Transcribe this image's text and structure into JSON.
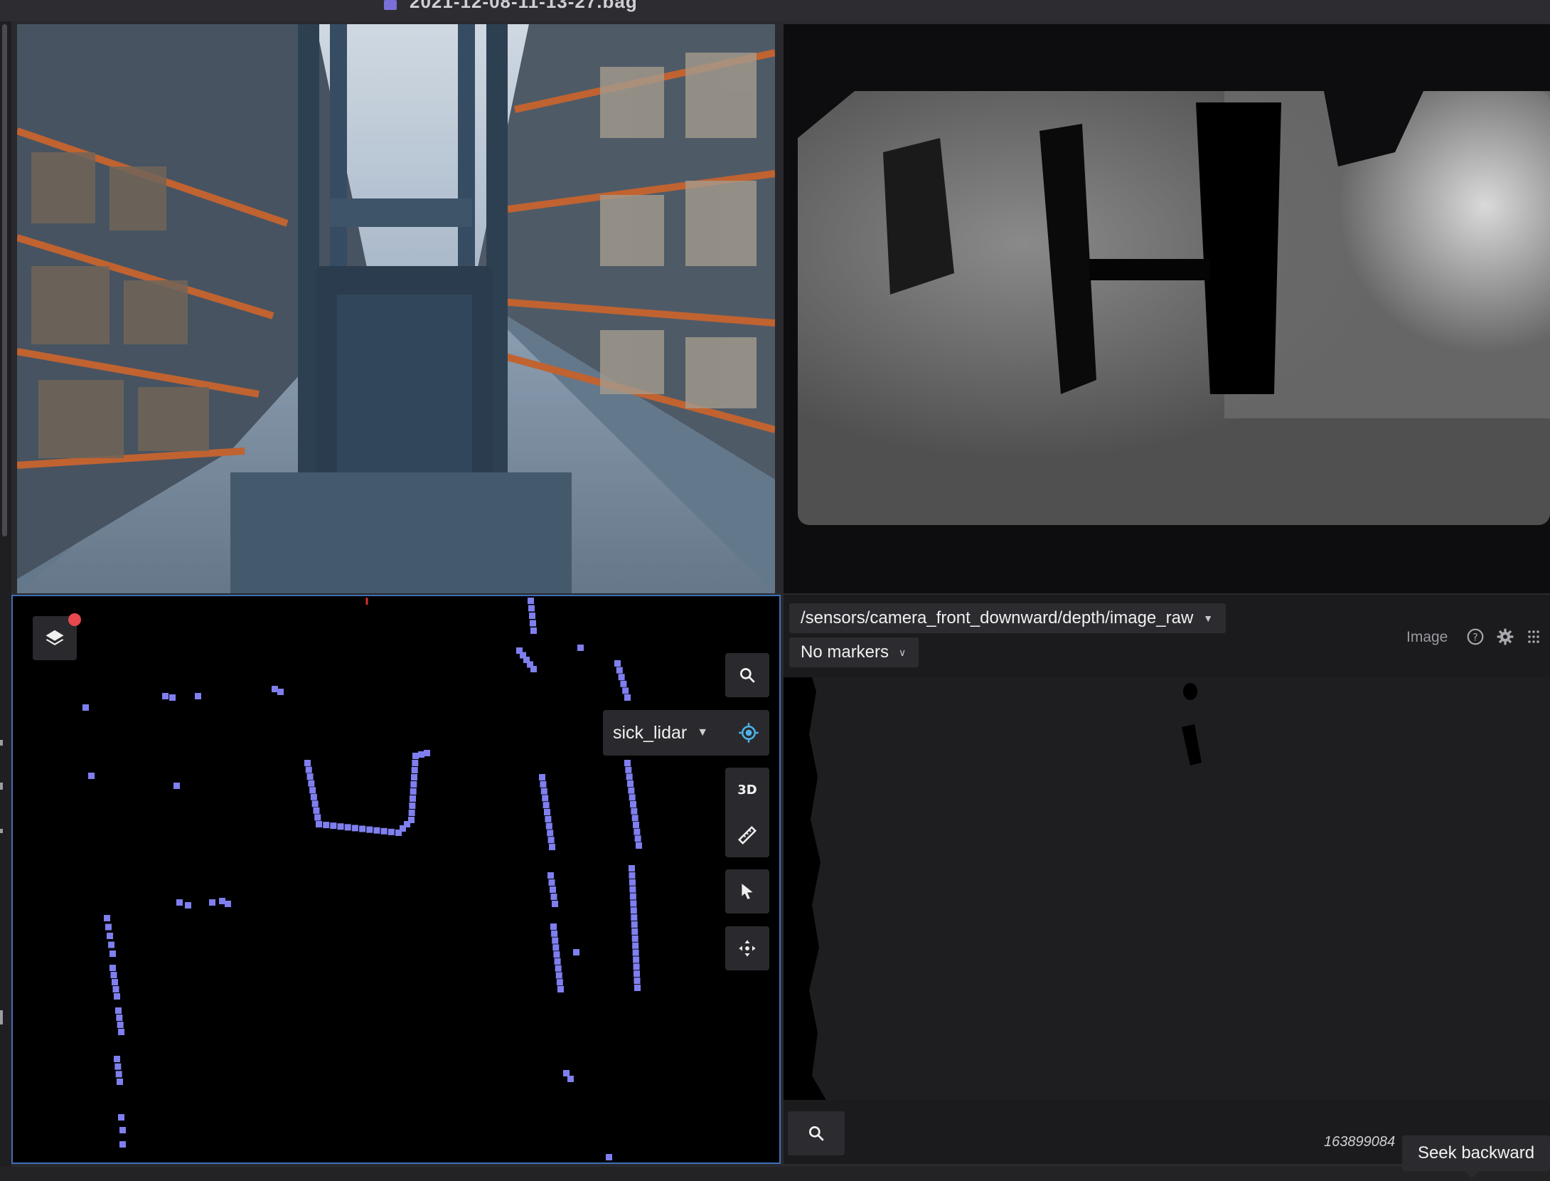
{
  "window": {
    "file_title": "2021-12-08-11-13-27.bag"
  },
  "three_d_panel": {
    "frame_select_value": "sick_lidar",
    "mode_3d_label": "3D",
    "lidar_point_color": "#7f7ff0",
    "layers_badge_color": "#e5484d"
  },
  "image_panel": {
    "topic_value": "/sensors/camera_front_downward/depth/image_raw",
    "markers_value": "No markers",
    "panel_type_label": "Image",
    "timestamp": "163899084"
  },
  "tooltip": {
    "text": "Seek backward"
  },
  "accent_color": "#3f6fb8"
}
